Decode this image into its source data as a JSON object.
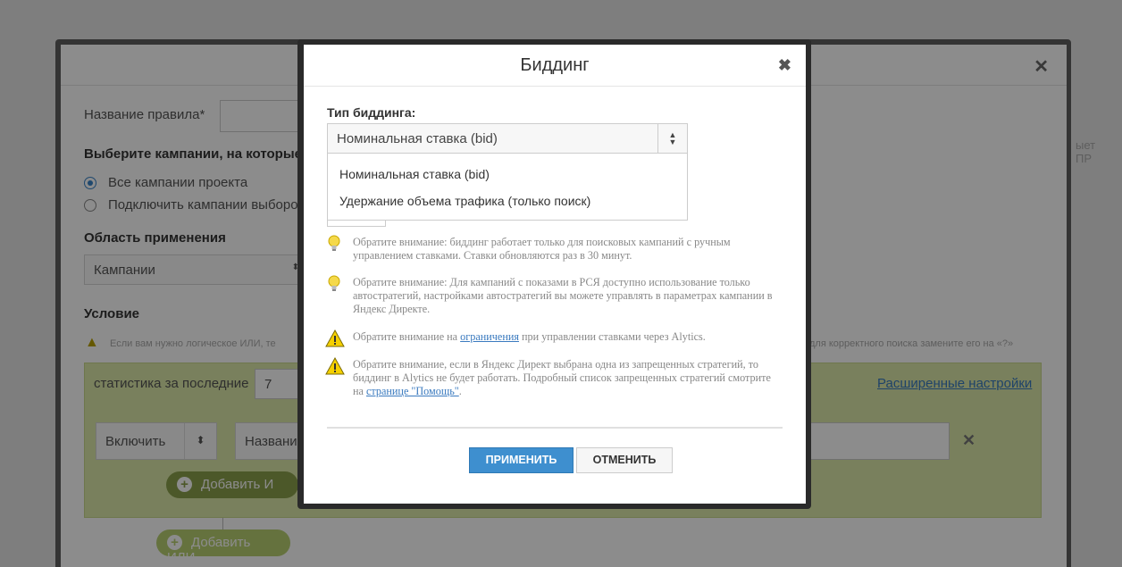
{
  "background": {
    "rule_name_label": "Название правила*",
    "campaigns_heading": "Выберите кампании, на которые",
    "radio_all": "Все кампании проекта",
    "radio_selected": "Подключить кампании выборо",
    "scope_heading": "Область применения",
    "scope_value": "Кампании",
    "condition_heading": "Условие",
    "condition_hint": "Если вам нужно логическое ИЛИ, те",
    "condition_hint_right": "для корректного поиска замените его на «?»",
    "stats_label": "статистика за последние",
    "stats_value": "7",
    "advanced_link": "Расширенные настройки",
    "include_value": "Включить",
    "name_field_value": "Название",
    "add_and_label": "Добавить И",
    "add_or_label": "Добавить ИЛИ",
    "right_edge_text": "ыет ПР"
  },
  "modal": {
    "title": "Биддинг",
    "field_label": "Тип биддинга:",
    "selected_value": "Номинальная ставка (bid)",
    "options": [
      "Номинальная ставка (bid)",
      "Удержание объема трафика (только поиск)"
    ],
    "notes": [
      {
        "icon": "lightbulb-icon",
        "text": "Обратите внимание: биддинг работает только для поисковых кампаний с ручным управлением ставками. Ставки обновляются раз в 30 минут."
      },
      {
        "icon": "lightbulb-icon",
        "text": "Обратите внимание: Для кампаний с показами в РСЯ доступно использование только автостратегий, настройками автостратегий вы можете управлять в параметрах кампании в Яндекс Директе."
      },
      {
        "icon": "warning-icon",
        "prefix": "Обратите внимание на ",
        "link": "ограничения",
        "suffix": " при управлении ставками через Alytics."
      },
      {
        "icon": "warning-icon",
        "prefix": "Обратите внимание, если в Яндекс Директ выбрана одна из запрещенных стратегий, то биддинг в Alytics не будет работать. Подробный список запрещенных стратегий смотрите на ",
        "link": "странице \"Помощь\"",
        "suffix": "."
      }
    ],
    "apply_label": "ПРИМЕНИТЬ",
    "cancel_label": "ОТМЕНИТЬ"
  },
  "colors": {
    "accent": "#3e8fcf",
    "link": "#3a7abf",
    "warning": "#f5d000",
    "condition_bg": "#dceaa9"
  }
}
